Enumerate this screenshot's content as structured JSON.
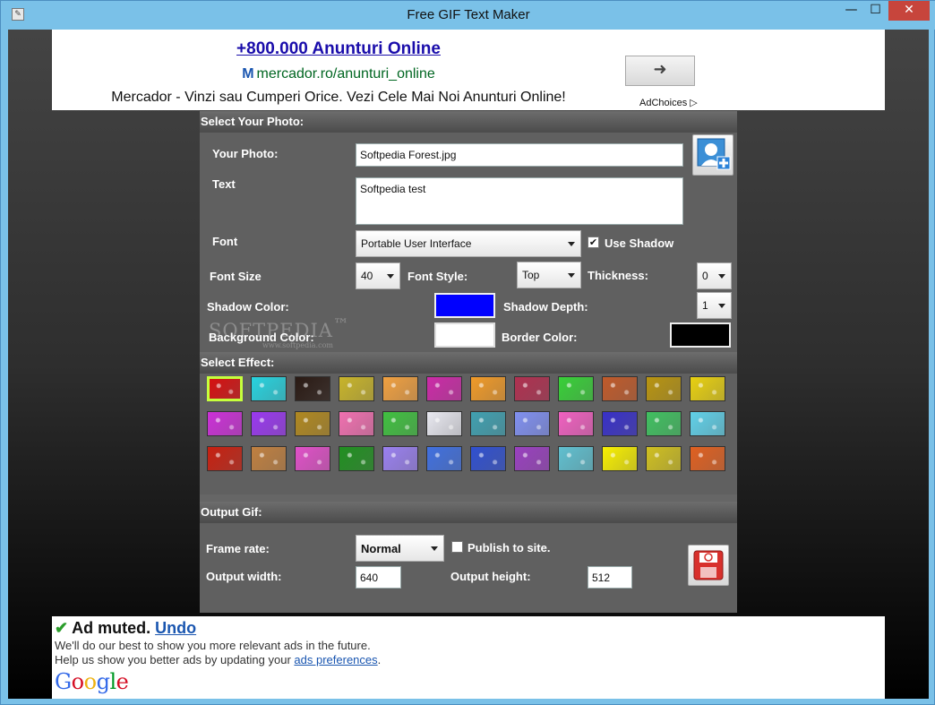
{
  "window": {
    "title": "Free GIF Text Maker",
    "min_glyph": "—",
    "max_glyph": "☐",
    "close_glyph": "✕"
  },
  "ad_top": {
    "headline": "+800.000 Anunturi Online",
    "url": "mercador.ro/anunturi_online",
    "url_logo": "M",
    "description": "Mercador - Vinzi sau Cumperi Orice. Vezi Cele Mai Noi Anunturi Online!",
    "go_glyph": "➜",
    "adchoices": "AdChoices ▷"
  },
  "select_photo": {
    "header": "Select Your Photo:",
    "photo_label": "Your Photo:",
    "photo_value": "Softpedia Forest.jpg",
    "text_label": "Text",
    "text_value": "Softpedia test",
    "font_label": "Font",
    "font_value": "Portable User Interface",
    "use_shadow_label": "Use Shadow",
    "use_shadow_checked": true,
    "font_size_label": "Font Size",
    "font_size_value": "40",
    "font_style_label": "Font Style:",
    "font_style_value": "Top",
    "thickness_label": "Thickness:",
    "thickness_value": "0",
    "shadow_color_label": "Shadow Color:",
    "shadow_color": "#0000ff",
    "shadow_depth_label": "Shadow Depth:",
    "shadow_depth_value": "1",
    "background_color_label": "Background Color:",
    "background_color": "#ffffff",
    "border_color_label": "Border Color:",
    "border_color": "#000000"
  },
  "watermark": {
    "brand": "SOFTPEDIA",
    "trademark": "™",
    "site": "www.softpedia.com"
  },
  "select_effect": {
    "header": "Select Effect:",
    "effects": [
      [
        "#d61010",
        "#27d3df",
        "#2a1a14",
        "#c8b42a",
        "#f0a040",
        "#cc2aa8",
        "#f09a28",
        "#b03050",
        "#38d038",
        "#c05a2a",
        "#b89410",
        "#e8d010"
      ],
      [
        "#cc30d8",
        "#9a38f0",
        "#b08820",
        "#f070b0",
        "#40c040",
        "#e8e8f0",
        "#40a0b0",
        "#8090f0",
        "#f060c0",
        "#3830c8",
        "#40c060",
        "#60d0e8"
      ],
      [
        "#c82010",
        "#c08040",
        "#e050c8",
        "#209020",
        "#9a80f0",
        "#4070e0",
        "#3050d0",
        "#9a40c0",
        "#60c0d0",
        "#f8f000",
        "#d0c020",
        "#e06020"
      ]
    ]
  },
  "output_gif": {
    "header": "Output Gif:",
    "frame_rate_label": "Frame rate:",
    "frame_rate_value": "Normal",
    "publish_label": "Publish to site.",
    "publish_checked": false,
    "output_width_label": "Output width:",
    "output_width_value": "640",
    "output_height_label": "Output height:",
    "output_height_value": "512"
  },
  "ad_bottom": {
    "muted": "Ad muted.",
    "undo": "Undo",
    "line1": "We'll do our best to show you more relevant ads in the future.",
    "line2_prefix": "Help us show you better ads by updating your",
    "line2_link": "ads preferences",
    "line2_suffix": ".",
    "brand": "Google"
  }
}
